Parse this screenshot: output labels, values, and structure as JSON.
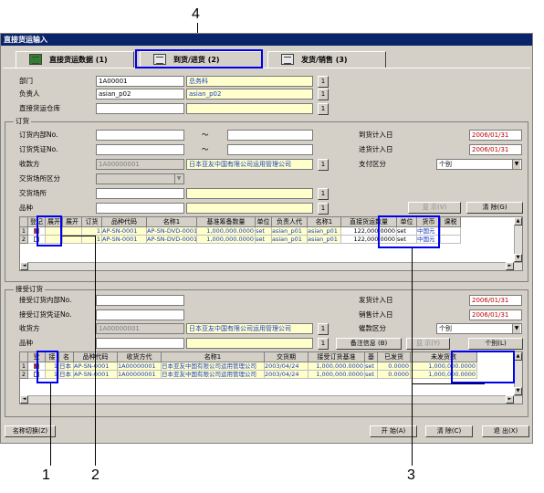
{
  "window": {
    "title": "直接货运输入"
  },
  "tabs": [
    {
      "label": "直接货运数据 (1)"
    },
    {
      "label": "到货/进货 (2)"
    },
    {
      "label": "发货/销售 (3)"
    }
  ],
  "header": {
    "dept_label": "部门",
    "dept_code": "1A00001",
    "dept_name": "总务科",
    "person_label": "负责人",
    "person_code": "asian_p02",
    "person_name": "asian_p02",
    "warehouse_label": "直接货运仓库",
    "lookup_btn": "1"
  },
  "order": {
    "group_label": "订货",
    "inner_no_label": "订货内部No.",
    "voucher_no_label": "订货凭证No.",
    "tilde": "～",
    "receiver_label": "收款方",
    "receiver_code": "1A00000001",
    "receiver_name": "日本亚友中国有限公司运用管理公司",
    "trade_place_type_label": "交货场所区分",
    "trade_place_label": "交货场所",
    "item_label": "品种",
    "arrival_plan_label": "到货计入日",
    "arrival_plan_date": "2006/01/31",
    "purchase_plan_label": "进货计入日",
    "purchase_plan_date": "2006/01/31",
    "payment_type_label": "支付区分",
    "payment_type_value": "个别",
    "display_btn": "显 示(V)",
    "clear_btn": "清 除(G)"
  },
  "order_grid": {
    "columns": [
      "登记",
      "展开",
      "展开",
      "订货",
      "品种代码",
      "名称1",
      "基准筹备数量",
      "单位",
      "负责人代",
      "名称1",
      "直接货运数量",
      "单位",
      "货币",
      "课税"
    ],
    "rows": [
      {
        "no": "1",
        "c3": "1",
        "c4": "1",
        "code": "AP-SN-0001",
        "name": "AP-SN-DVD-0001",
        "qty": "1,000,000.0000",
        "unit": "set",
        "person": "asian_p01",
        "pname": "asian_p01",
        "direct_qty": "122,000.0000",
        "unit2": "set",
        "currency": "中国元"
      },
      {
        "no": "2",
        "c3": "1",
        "c4": "1",
        "code": "AP-SN-0001",
        "name": "AP-SN-DVD-0001",
        "qty": "1,000,000.0000",
        "unit": "set",
        "person": "asian_p01",
        "pname": "asian_p01",
        "direct_qty": "122,000.0000",
        "unit2": "set",
        "currency": "中国元"
      }
    ]
  },
  "receive": {
    "group_label": "接受订货",
    "inner_no_label": "接受订货内部No.",
    "voucher_no_label": "接受订货凭证No.",
    "receiver_label": "收货方",
    "receiver_code": "1A00000001",
    "receiver_name": "日本亚友中国有限公司运用管理公司",
    "item_label": "品种",
    "ship_plan_label": "发货计入日",
    "ship_plan_date": "2006/01/31",
    "sales_plan_label": "销售计入日",
    "sales_plan_date": "2006/01/31",
    "billing_type_label": "催款区分",
    "billing_type_value": "个别",
    "remarks_btn": "备注信息 (B)",
    "display_btn": "显 示(Y)",
    "individual_btn": "个别(L)"
  },
  "receive_grid": {
    "columns": [
      "登",
      "接",
      "名",
      "品种代码",
      "收货方代",
      "名称1",
      "交货期",
      "接受订货基准",
      "基",
      "已发货",
      "未发货数"
    ],
    "rows": [
      {
        "no": "1",
        "c2": "1",
        "c3": "日本",
        "code": "AP-SN-0001",
        "recv": "1A00000001",
        "name": "日本亚友中国有限公司运用管理公司",
        "date": "2003/04/24",
        "base_qty": "1,000,000.0000",
        "unit": "set",
        "shipped": "0.0000",
        "unshipped": "1,000,000.0000"
      },
      {
        "no": "2",
        "c2": "1",
        "c3": "日本",
        "code": "AP-SN-0001",
        "recv": "1A00000001",
        "name": "日本亚友中国有限公司运用管理公司",
        "date": "2003/04/24",
        "base_qty": "1,000,000.0000",
        "unit": "set",
        "shipped": "0.0000",
        "unshipped": "1,000,000.0000"
      }
    ]
  },
  "footer": {
    "switch_btn": "名称切换(Z)",
    "start_btn": "开 始(A)",
    "clear_btn": "清 除(C)",
    "exit_btn": "退 出(X)"
  },
  "callouts": {
    "n1": "1",
    "n2": "2",
    "n3": "3",
    "n4": "4"
  },
  "colors": {
    "callout": "#0000ee",
    "title": "#0a246a",
    "yellow": "#ffffcc",
    "date_red": "#c00000"
  }
}
